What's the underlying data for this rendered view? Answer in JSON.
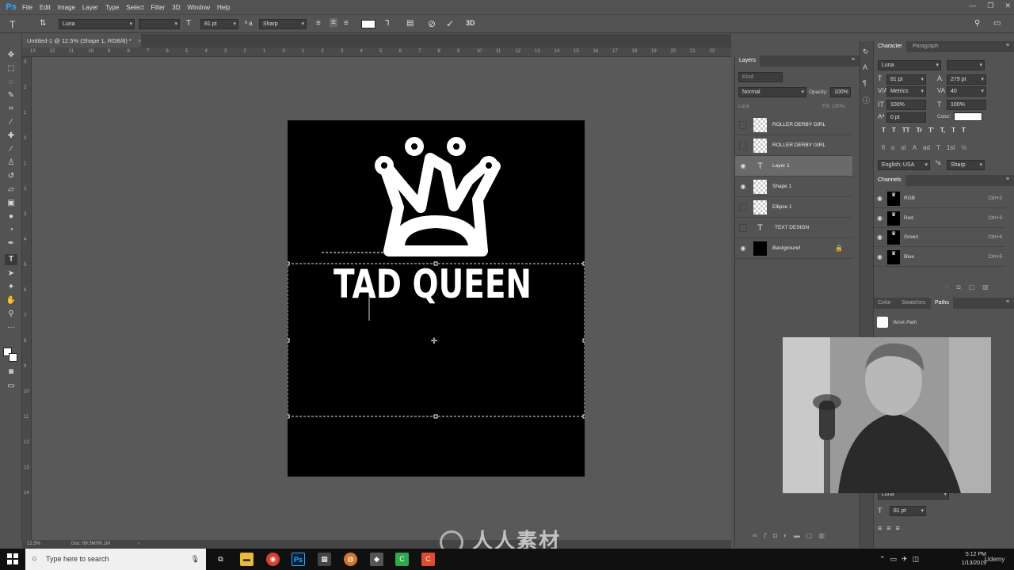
{
  "app": {
    "logo": "Ps"
  },
  "menu": [
    "File",
    "Edit",
    "Image",
    "Layer",
    "Type",
    "Select",
    "Filter",
    "3D",
    "Window",
    "Help"
  ],
  "options_bar": {
    "tool_icon": "T",
    "font_family": "Luna",
    "font_size": "81 pt",
    "antialias": "Sharp",
    "threed_label": "3D"
  },
  "document_tab": {
    "title": "Untitled-1 @ 12.5% (Shape 1, RGB/8) *",
    "close": "×"
  },
  "ruler_h_ticks": [
    "13",
    "12",
    "11",
    "10",
    "9",
    "8",
    "7",
    "6",
    "5",
    "4",
    "3",
    "2",
    "1",
    "0",
    "1",
    "2",
    "3",
    "4",
    "5",
    "6",
    "7",
    "8",
    "9",
    "10",
    "11",
    "12",
    "13",
    "14",
    "15",
    "16",
    "17",
    "18",
    "19",
    "20",
    "21",
    "22"
  ],
  "ruler_v_ticks": [
    "3",
    "2",
    "1",
    "0",
    "1",
    "2",
    "3",
    "4",
    "5",
    "6",
    "7",
    "8",
    "9",
    "10",
    "11",
    "12",
    "13",
    "14"
  ],
  "canvas": {
    "text": "TAD QUEEN"
  },
  "status_bar": {
    "zoom": "12.5%",
    "doc": "Doc: 69.5M/90.1M"
  },
  "layers_panel": {
    "tab": "Layers",
    "filter_placeholder": "Kind",
    "blend_mode": "Normal",
    "opacity_label": "Opacity:",
    "opacity_value": "100%",
    "lock_label": "Lock:",
    "fill_label": "Fill:",
    "fill_value": "100%",
    "layers": [
      {
        "name": "ROLLER DERBY GIRL",
        "thumb": "check",
        "visible": false,
        "selected": false
      },
      {
        "name": "ROLLER DERBY GIRL",
        "thumb": "check",
        "visible": false,
        "selected": false
      },
      {
        "name": "Layer 1",
        "thumb": "text",
        "visible": true,
        "selected": true
      },
      {
        "name": "Shape 1",
        "thumb": "check",
        "visible": true,
        "selected": false
      },
      {
        "name": "Ellipse 1",
        "thumb": "check",
        "visible": false,
        "selected": false
      },
      {
        "name": "TEXT DESIGN",
        "thumb": "text",
        "visible": false,
        "selected": false
      },
      {
        "name": "Background",
        "thumb": "black",
        "visible": true,
        "selected": false
      }
    ]
  },
  "character_panel": {
    "tabs": [
      "Character",
      "Paragraph"
    ],
    "font_family": "Luna",
    "font_size": "81 pt",
    "leading": "279 pt",
    "kerning": "Metrics",
    "tracking": "40",
    "vertical_scale": "100%",
    "horizontal_scale": "100%",
    "baseline": "0 pt",
    "color_label": "Color:",
    "style_buttons": [
      "T",
      "T",
      "TT",
      "Tr",
      "T'",
      "T,",
      "T",
      "T"
    ],
    "opentype_buttons": [
      "fi",
      "o",
      "st",
      "A",
      "ad",
      "T",
      "1st",
      "½"
    ],
    "language": "English: USA",
    "antialias": "Sharp"
  },
  "channels_panel": {
    "tab": "Channels",
    "channels": [
      {
        "name": "RGB",
        "key": "Ctrl+2"
      },
      {
        "name": "Red",
        "key": "Ctrl+3"
      },
      {
        "name": "Green",
        "key": "Ctrl+4"
      },
      {
        "name": "Blue",
        "key": "Ctrl+5"
      }
    ]
  },
  "paths_panel": {
    "tabs": [
      "Color",
      "Swatches",
      "Paths"
    ],
    "paths": [
      "Work Path"
    ]
  },
  "lower_options": {
    "font_family": "Luna",
    "font_size": "81 pt"
  },
  "taskbar": {
    "search_placeholder": "Type here to search",
    "time": "5:12 PM",
    "date": "1/13/2019"
  },
  "watermark": {
    "text": "人人素材",
    "extra": "Udemy"
  },
  "colors": {
    "accent": "#31a8ff",
    "panel": "#535353",
    "canvas": "#000000"
  }
}
